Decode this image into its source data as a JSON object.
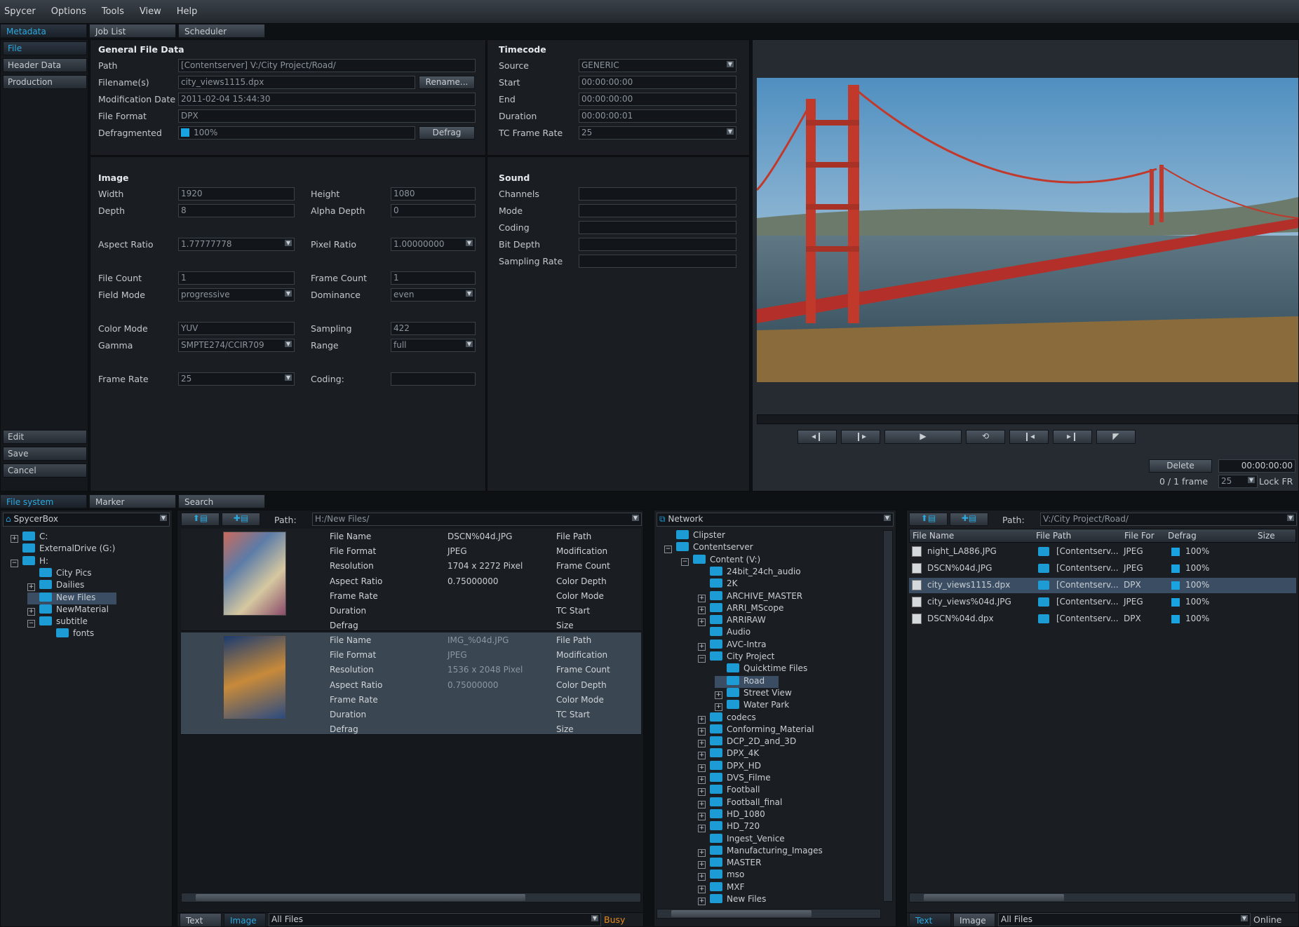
{
  "menu": [
    "Spycer",
    "Options",
    "Tools",
    "View",
    "Help"
  ],
  "top_tabs": [
    "Metadata",
    "Job List",
    "Scheduler"
  ],
  "side_nav": {
    "items": [
      "File",
      "Header Data",
      "Production"
    ],
    "actions": [
      "Edit",
      "Save",
      "Cancel"
    ]
  },
  "general": {
    "title": "General File Data",
    "path_label": "Path",
    "path": "[Contentserver] V:/City Project/Road/",
    "filename_label": "Filename(s)",
    "filename": "city_views1115.dpx",
    "rename": "Rename...",
    "moddate_label": "Modification Date",
    "moddate": "2011-02-04 15:44:30",
    "format_label": "File Format",
    "format": "DPX",
    "defrag_label": "Defragmented",
    "defrag_value": "100%",
    "defrag_btn": "Defrag"
  },
  "timecode": {
    "title": "Timecode",
    "source_label": "Source",
    "source": "GENERIC",
    "start_label": "Start",
    "start": "00:00:00:00",
    "end_label": "End",
    "end": "00:00:00:00",
    "duration_label": "Duration",
    "duration": "00:00:00:01",
    "tcrate_label": "TC Frame Rate",
    "tcrate": "25"
  },
  "image": {
    "title": "Image",
    "width_label": "Width",
    "width": "1920",
    "height_label": "Height",
    "height": "1080",
    "depth_label": "Depth",
    "depth": "8",
    "alpha_label": "Alpha Depth",
    "alpha": "0",
    "aspect_label": "Aspect Ratio",
    "aspect": "1.77777778",
    "pixel_label": "Pixel Ratio",
    "pixel": "1.00000000",
    "filecount_label": "File Count",
    "filecount": "1",
    "framecount_label": "Frame Count",
    "framecount": "1",
    "fieldmode_label": "Field Mode",
    "fieldmode": "progressive",
    "dominance_label": "Dominance",
    "dominance": "even",
    "colormode_label": "Color Mode",
    "colormode": "YUV",
    "sampling_label": "Sampling",
    "sampling": "422",
    "gamma_label": "Gamma",
    "gamma": "SMPTE274/CCIR709",
    "range_label": "Range",
    "range": "full",
    "framerate_label": "Frame Rate",
    "framerate": "25",
    "coding_label": "Coding:",
    "coding": ""
  },
  "sound": {
    "title": "Sound",
    "labels": [
      "Channels",
      "Mode",
      "Coding",
      "Bit Depth",
      "Sampling Rate"
    ]
  },
  "player": {
    "delete": "Delete",
    "timecode": "00:00:00:00",
    "frame_info": "0 / 1 frame",
    "fps": "25",
    "lock": "Lock FR"
  },
  "bottom_tabs": [
    "File system",
    "Marker",
    "Search"
  ],
  "tree": {
    "root": "SpycerBox",
    "items": [
      {
        "label": "C:",
        "level": 0,
        "exp": "+"
      },
      {
        "label": "ExternalDrive (G:)",
        "level": 0,
        "exp": ""
      },
      {
        "label": "H:",
        "level": 0,
        "exp": "-"
      },
      {
        "label": "City Pics",
        "level": 1,
        "exp": ""
      },
      {
        "label": "Dailies",
        "level": 1,
        "exp": "+"
      },
      {
        "label": "New Files",
        "level": 1,
        "exp": ""
      },
      {
        "label": "NewMaterial",
        "level": 1,
        "exp": "+"
      },
      {
        "label": "subtitle",
        "level": 1,
        "exp": "-"
      },
      {
        "label": "fonts",
        "level": 2,
        "exp": ""
      }
    ]
  },
  "browser": {
    "path_label": "Path:",
    "path": "H:/New Files/",
    "cards": [
      {
        "keys": [
          "File Name",
          "File Format",
          "Resolution",
          "Aspect Ratio",
          "Frame Rate",
          "Duration",
          "Defrag"
        ],
        "vals": [
          "DSCN%04d.JPG",
          "JPEG",
          "1704 x 2272 Pixel",
          "0.75000000",
          "",
          "",
          ""
        ],
        "keys2": [
          "File Path",
          "Modification",
          "Frame Count",
          "Color Depth",
          "Color Mode",
          "TC Start",
          "Size"
        ]
      },
      {
        "keys": [
          "File Name",
          "File Format",
          "Resolution",
          "Aspect Ratio",
          "Frame Rate",
          "Duration",
          "Defrag"
        ],
        "vals": [
          "IMG_%04d.JPG",
          "JPEG",
          "1536 x 2048 Pixel",
          "0.75000000",
          "",
          "",
          ""
        ],
        "keys2": [
          "File Path",
          "Modification",
          "Frame Count",
          "Color Depth",
          "Color Mode",
          "TC Start",
          "Size"
        ]
      }
    ],
    "status": {
      "text": "Text",
      "image": "Image",
      "filter": "All Files",
      "state": "Busy"
    }
  },
  "network": {
    "title": "Network",
    "items": [
      {
        "label": "Clipster",
        "level": 0,
        "exp": ""
      },
      {
        "label": "Contentserver",
        "level": 0,
        "exp": "-"
      },
      {
        "label": "Content (V:)",
        "level": 1,
        "exp": "-"
      },
      {
        "label": "24bit_24ch_audio",
        "level": 2,
        "exp": ""
      },
      {
        "label": "2K",
        "level": 2,
        "exp": ""
      },
      {
        "label": "ARCHIVE_MASTER",
        "level": 2,
        "exp": "+"
      },
      {
        "label": "ARRI_MScope",
        "level": 2,
        "exp": "+"
      },
      {
        "label": "ARRIRAW",
        "level": 2,
        "exp": "+"
      },
      {
        "label": "Audio",
        "level": 2,
        "exp": ""
      },
      {
        "label": "AVC-Intra",
        "level": 2,
        "exp": "+"
      },
      {
        "label": "City Project",
        "level": 2,
        "exp": "-"
      },
      {
        "label": "Quicktime Files",
        "level": 3,
        "exp": ""
      },
      {
        "label": "Road",
        "level": 3,
        "exp": ""
      },
      {
        "label": "Street View",
        "level": 3,
        "exp": "+"
      },
      {
        "label": "Water Park",
        "level": 3,
        "exp": "+"
      },
      {
        "label": "codecs",
        "level": 2,
        "exp": "+"
      },
      {
        "label": "Conforming_Material",
        "level": 2,
        "exp": "+"
      },
      {
        "label": "DCP_2D_and_3D",
        "level": 2,
        "exp": "+"
      },
      {
        "label": "DPX_4K",
        "level": 2,
        "exp": "+"
      },
      {
        "label": "DPX_HD",
        "level": 2,
        "exp": "+"
      },
      {
        "label": "DVS_Filme",
        "level": 2,
        "exp": "+"
      },
      {
        "label": "Football",
        "level": 2,
        "exp": "+"
      },
      {
        "label": "Football_final",
        "level": 2,
        "exp": "+"
      },
      {
        "label": "HD_1080",
        "level": 2,
        "exp": "+"
      },
      {
        "label": "HD_720",
        "level": 2,
        "exp": "+"
      },
      {
        "label": "Ingest_Venice",
        "level": 2,
        "exp": ""
      },
      {
        "label": "Manufacturing_Images",
        "level": 2,
        "exp": "+"
      },
      {
        "label": "MASTER",
        "level": 2,
        "exp": "+"
      },
      {
        "label": "mso",
        "level": 2,
        "exp": "+"
      },
      {
        "label": "MXF",
        "level": 2,
        "exp": "+"
      },
      {
        "label": "New Files",
        "level": 2,
        "exp": "+"
      }
    ]
  },
  "filelist": {
    "path_label": "Path:",
    "path": "V:/City Project/Road/",
    "columns": [
      "File Name",
      "File Path",
      "File For",
      "Defrag",
      "Size"
    ],
    "rows": [
      {
        "name": "night_LA886.JPG",
        "path": "[Contentserv...",
        "fmt": "JPEG",
        "defrag": "100%",
        "selected": false
      },
      {
        "name": "DSCN%04d.JPG",
        "path": "[Contentserv...",
        "fmt": "JPEG",
        "defrag": "100%",
        "selected": false
      },
      {
        "name": "city_views1115.dpx",
        "path": "[Contentserv...",
        "fmt": "DPX",
        "defrag": "100%",
        "selected": true
      },
      {
        "name": "city_views%04d.JPG",
        "path": "[Contentserv...",
        "fmt": "JPEG",
        "defrag": "100%",
        "selected": false
      },
      {
        "name": "DSCN%04d.dpx",
        "path": "[Contentserv...",
        "fmt": "DPX",
        "defrag": "100%",
        "selected": false
      }
    ],
    "status": {
      "text": "Text",
      "image": "Image",
      "filter": "All Files",
      "state": "Online"
    }
  }
}
